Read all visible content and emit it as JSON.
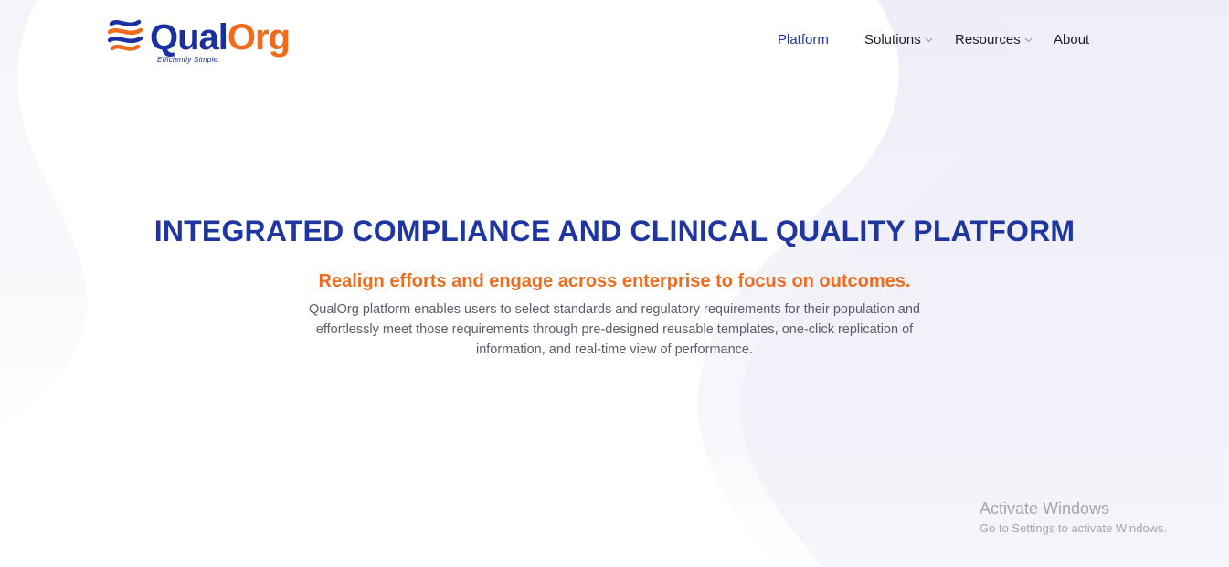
{
  "brand": {
    "name_part1": "Qual",
    "name_part2": "Org",
    "tagline": "Efficiently Simple.",
    "primary_color": "#1a2fa0",
    "accent_color": "#f26b1d"
  },
  "nav": {
    "items": [
      {
        "label": "Platform",
        "active": true,
        "has_dropdown": false
      },
      {
        "label": "Solutions",
        "active": false,
        "has_dropdown": true
      },
      {
        "label": "Resources",
        "active": false,
        "has_dropdown": true
      },
      {
        "label": "About",
        "active": false,
        "has_dropdown": false
      }
    ]
  },
  "hero": {
    "title": "INTEGRATED COMPLIANCE AND CLINICAL QUALITY PLATFORM",
    "subtitle": "Realign efforts and engage across enterprise to focus on outcomes.",
    "description": "QualOrg platform enables users to select standards and regulatory requirements for their population and effortlessly meet those requirements through pre-designed reusable templates, one-click replication of information, and real-time view of performance."
  },
  "watermark": {
    "title": "Activate Windows",
    "subtitle": "Go to Settings to activate Windows."
  },
  "icons": {
    "logo": "qualorg-logo-icon",
    "dropdown": "chevron-down-icon"
  }
}
